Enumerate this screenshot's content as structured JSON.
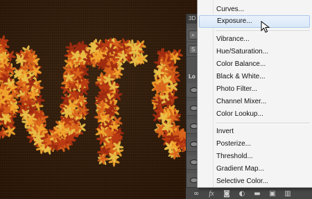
{
  "canvas": {
    "background_color": "#2b1707",
    "leaf_colors": [
      "#d9641b",
      "#f0a52c",
      "#b83a12",
      "#e8c048",
      "#9e2a10"
    ]
  },
  "layers_panel": {
    "tab_label": "3D",
    "locked_label": "Lo"
  },
  "adjustment_menu": {
    "items": [
      {
        "label": "Curves...",
        "highlighted": false
      },
      {
        "label": "Exposure...",
        "highlighted": true
      },
      {
        "label": "Vibrance...",
        "highlighted": false
      },
      {
        "label": "Hue/Saturation...",
        "highlighted": false
      },
      {
        "label": "Color Balance...",
        "highlighted": false
      },
      {
        "label": "Black & White...",
        "highlighted": false
      },
      {
        "label": "Photo Filter...",
        "highlighted": false
      },
      {
        "label": "Channel Mixer...",
        "highlighted": false
      },
      {
        "label": "Color Lookup...",
        "highlighted": false
      },
      {
        "label": "Invert",
        "highlighted": false
      },
      {
        "label": "Posterize...",
        "highlighted": false
      },
      {
        "label": "Threshold...",
        "highlighted": false
      },
      {
        "label": "Gradient Map...",
        "highlighted": false
      },
      {
        "label": "Selective Color...",
        "highlighted": false
      }
    ]
  },
  "bottom_toolbar": {
    "icons": [
      "link-icon",
      "fx-icon",
      "mask-icon",
      "adjustment-icon",
      "folder-icon",
      "new-layer-icon",
      "trash-icon"
    ],
    "fx_label": "fx"
  }
}
